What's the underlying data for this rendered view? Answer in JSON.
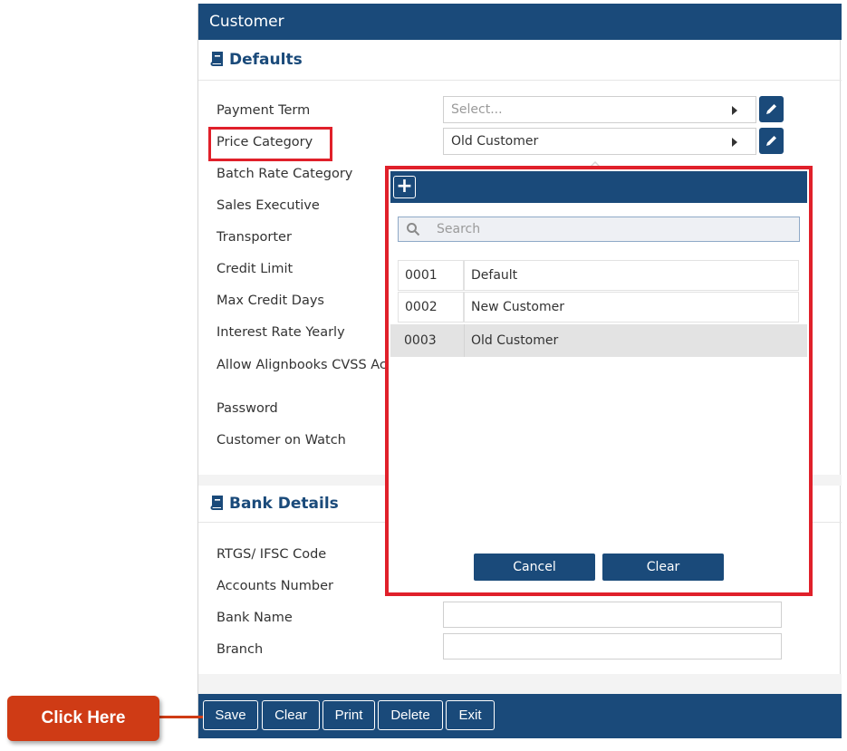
{
  "panel": {
    "title": "Customer"
  },
  "defaults": {
    "title": "Defaults",
    "fields": [
      {
        "label": "Payment Term"
      },
      {
        "label": "Price Category"
      },
      {
        "label": "Batch Rate Category"
      },
      {
        "label": "Sales Executive"
      },
      {
        "label": "Transporter"
      },
      {
        "label": "Credit Limit"
      },
      {
        "label": "Max Credit Days"
      },
      {
        "label": "Interest Rate Yearly"
      },
      {
        "label": "Allow Alignbooks CVSS Ac"
      },
      {
        "label": "Password"
      },
      {
        "label": "Customer on Watch"
      }
    ],
    "payment_term_placeholder": "Select...",
    "price_category_value": "Old Customer"
  },
  "bank": {
    "title": "Bank Details",
    "fields": [
      {
        "label": "RTGS/ IFSC Code"
      },
      {
        "label": "Accounts Number"
      },
      {
        "label": "Bank Name"
      },
      {
        "label": "Branch"
      }
    ]
  },
  "dropdown": {
    "add_icon": "plus-icon",
    "search_placeholder": "Search",
    "options": [
      {
        "code": "0001",
        "name": "Default"
      },
      {
        "code": "0002",
        "name": "New Customer"
      },
      {
        "code": "0003",
        "name": "Old Customer",
        "selected": true
      }
    ],
    "cancel_label": "Cancel",
    "clear_label": "Clear"
  },
  "toolbar": {
    "save": "Save",
    "clear": "Clear",
    "print": "Print",
    "delete": "Delete",
    "exit": "Exit"
  },
  "callout": {
    "text": "Click Here"
  },
  "colors": {
    "primary": "#1a4a7a",
    "highlight": "#e0202a",
    "callout": "#cf3b15"
  }
}
